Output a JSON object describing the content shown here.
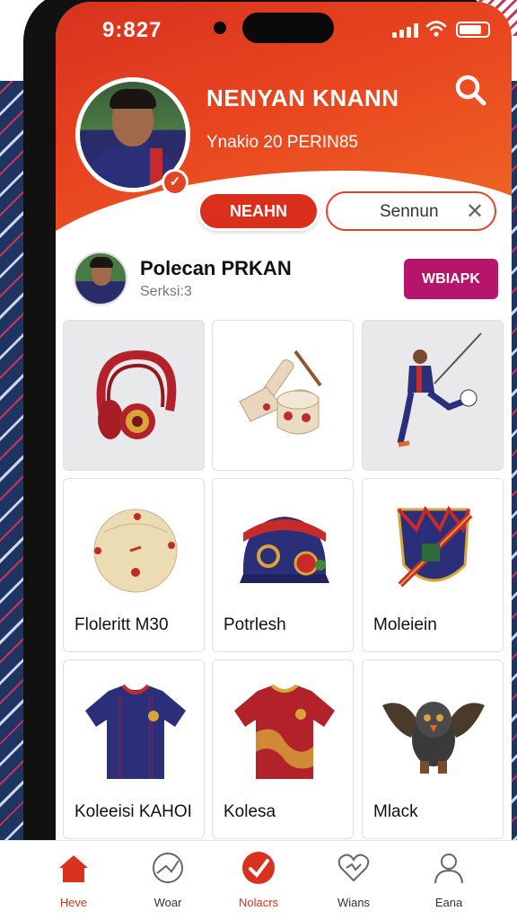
{
  "status_bar": {
    "time": "9:827"
  },
  "header": {
    "name": "NENYAN KNANN",
    "subtitle": "Ynakio 20 PERIN85",
    "tab_active": "NEAHN",
    "tab_input": "Sennun",
    "search_icon": "search-icon",
    "accent": "#d8321f"
  },
  "profile_row": {
    "name": "Polecan PRKAN",
    "sub": "Serksi:3",
    "button": "WBIAPK",
    "button_color": "#b5166b"
  },
  "items": [
    {
      "icon": "headphones-icon",
      "label": ""
    },
    {
      "icon": "drum-icon",
      "label": ""
    },
    {
      "icon": "player-kick-icon",
      "label": ""
    },
    {
      "icon": "ball-icon",
      "label": "Floleritt M30"
    },
    {
      "icon": "cap-icon",
      "label": "Potrlesh"
    },
    {
      "icon": "crest-icon",
      "label": "Moleiein"
    },
    {
      "icon": "jersey-blue-icon",
      "label": "Koleeisi KAHOI"
    },
    {
      "icon": "jersey-red-icon",
      "label": "Kolesa"
    },
    {
      "icon": "mascot-icon",
      "label": "Mlack"
    }
  ],
  "bottom_nav": [
    {
      "icon": "home-icon",
      "label": "Heve",
      "active": true
    },
    {
      "icon": "ball-outline-icon",
      "label": "Woar",
      "active": false
    },
    {
      "icon": "check-circle-icon",
      "label": "Nolacrs",
      "active": false
    },
    {
      "icon": "heart-icon",
      "label": "Wians",
      "active": false
    },
    {
      "icon": "person-icon",
      "label": "Eana",
      "active": false
    }
  ]
}
